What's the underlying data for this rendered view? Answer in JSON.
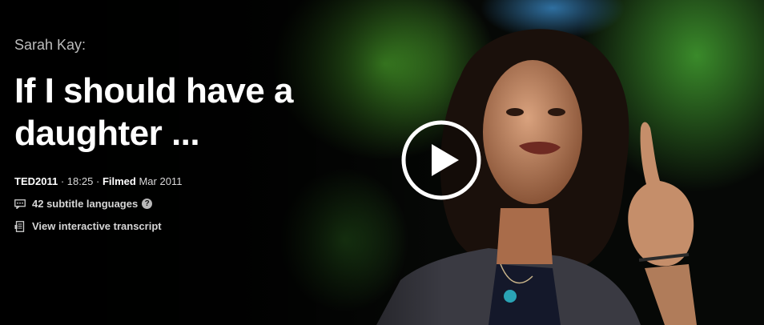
{
  "talk": {
    "speaker": "Sarah Kay:",
    "title_line1": "If I should have a",
    "title_line2": "daughter ...",
    "event": "TED2011",
    "separator": "·",
    "duration": "18:25",
    "filmed_label": "Filmed",
    "filmed_date": "Mar 2011",
    "subtitles": "42 subtitle languages",
    "help_glyph": "?",
    "transcript": "View interactive transcript"
  },
  "colors": {
    "background": "#000000",
    "stage_green": "#3f8a1e",
    "text_primary": "#ffffff",
    "text_muted": "#bdbdbd"
  },
  "icons": {
    "play": "play-icon",
    "subtitles": "subtitles-icon",
    "help": "help-icon",
    "transcript": "transcript-icon"
  }
}
